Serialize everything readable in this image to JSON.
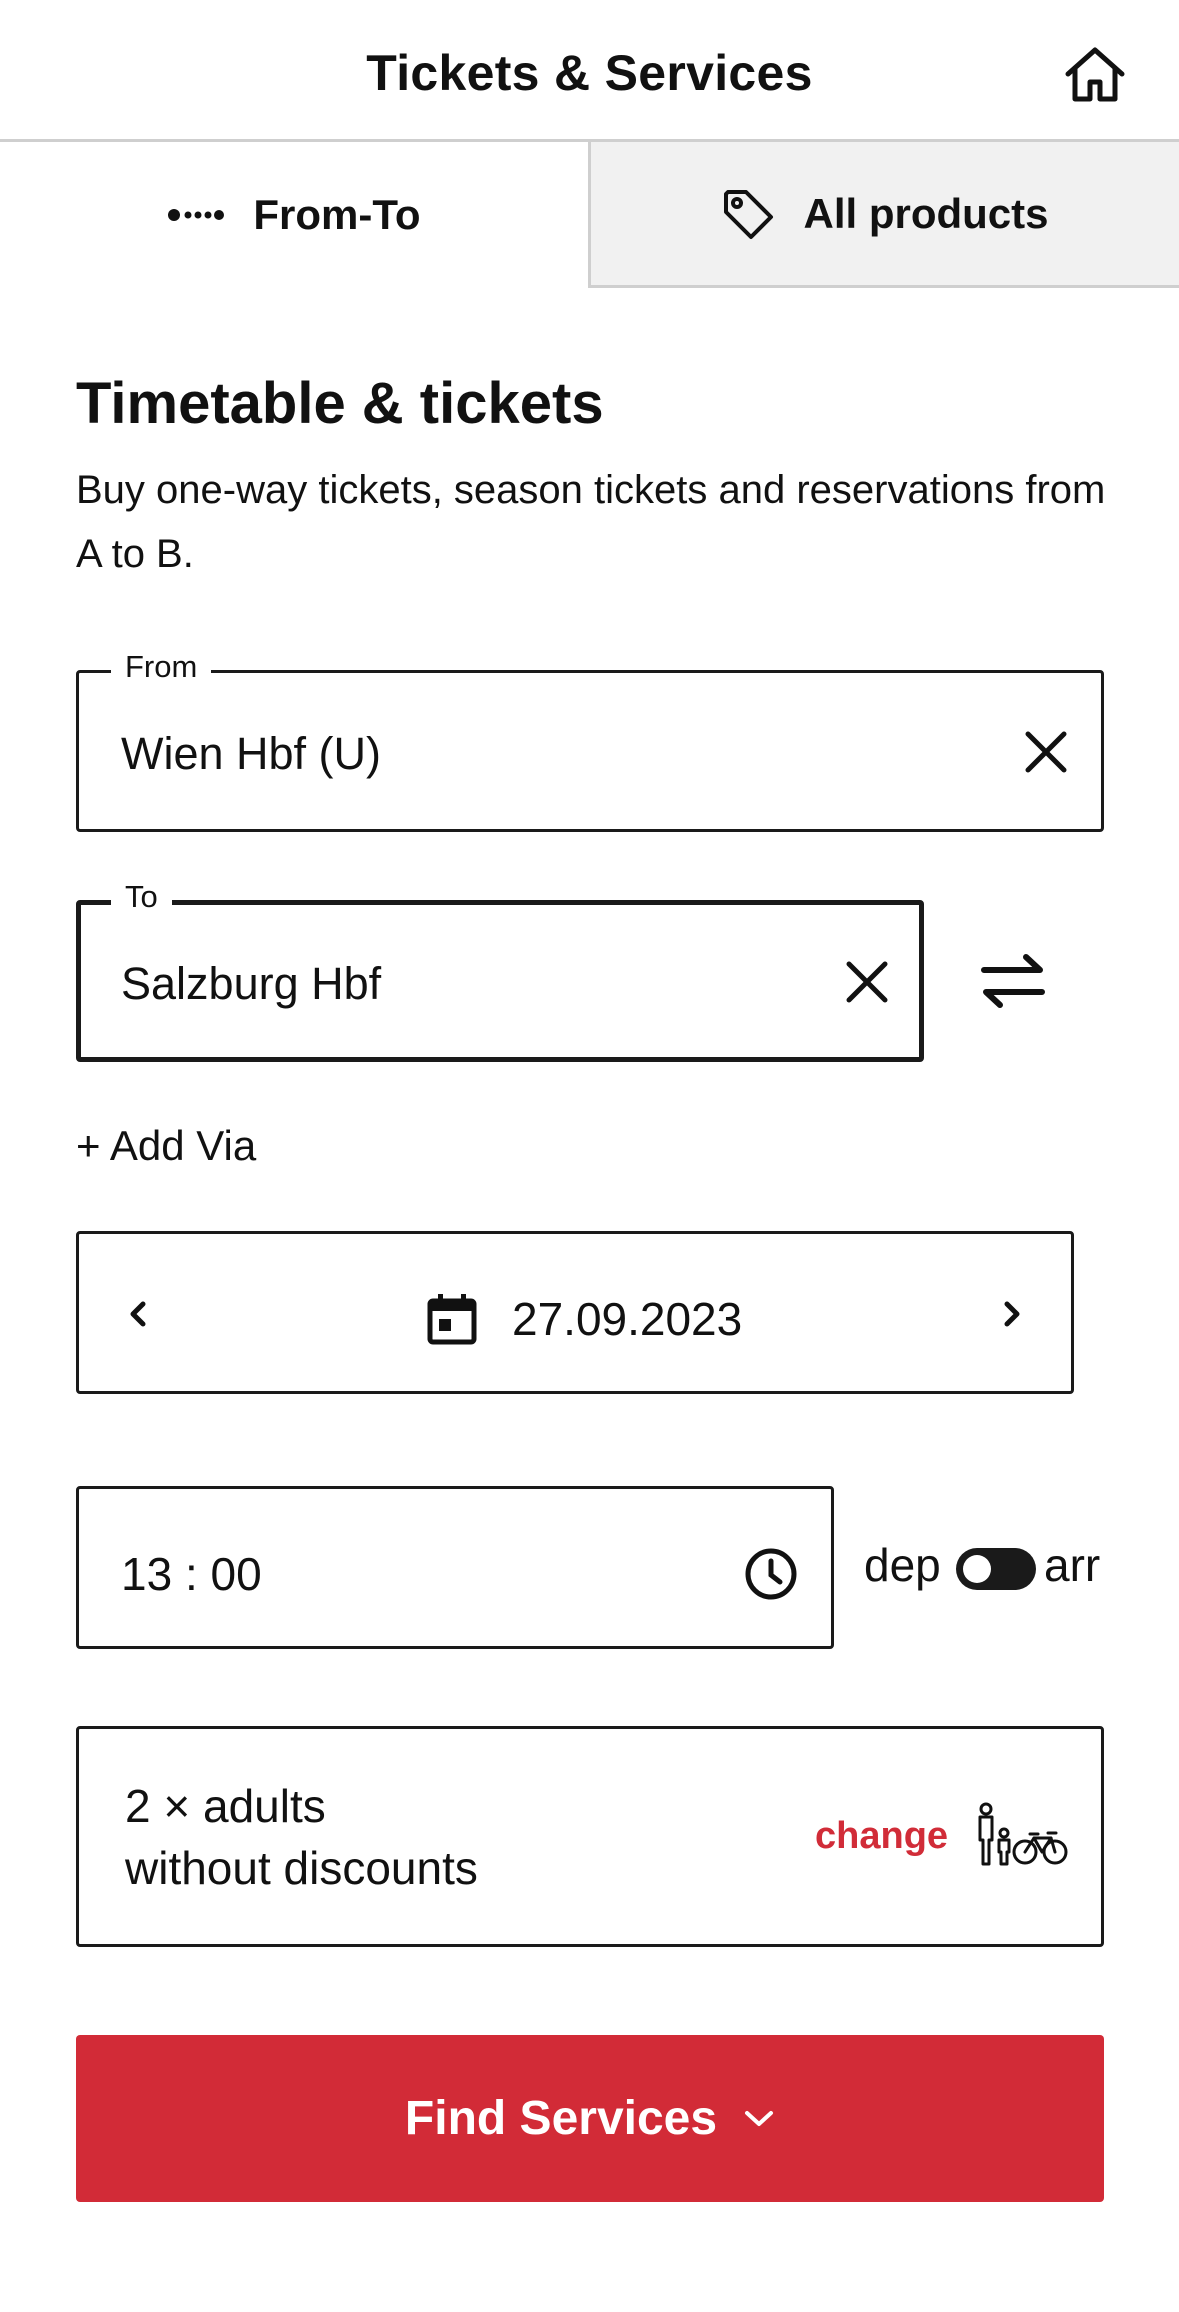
{
  "header": {
    "title": "Tickets & Services"
  },
  "tabs": [
    {
      "label": "From-To",
      "active": true,
      "icon": "route-dots-icon"
    },
    {
      "label": "All products",
      "active": false,
      "icon": "tag-icon"
    }
  ],
  "intro": {
    "title": "Timetable & tickets",
    "description": "Buy one-way tickets, season tickets and reservations from A to B."
  },
  "from": {
    "label": "From",
    "value": "Wien Hbf (U)"
  },
  "to": {
    "label": "To",
    "value": "Salzburg Hbf"
  },
  "add_via": "+ Add Via",
  "date": {
    "value": "27.09.2023"
  },
  "time": {
    "value": "13 : 00"
  },
  "mode_toggle": {
    "dep_label": "dep",
    "arr_label": "arr",
    "selected": "dep"
  },
  "passengers": {
    "line1": "2 × adults",
    "line2": "without discounts",
    "change_label": "change"
  },
  "find_button": {
    "label": "Find Services"
  },
  "colors": {
    "accent": "#d22b37",
    "text": "#111111",
    "border": "#1a1a1a",
    "inactive_tab": "#f1f1f1"
  }
}
